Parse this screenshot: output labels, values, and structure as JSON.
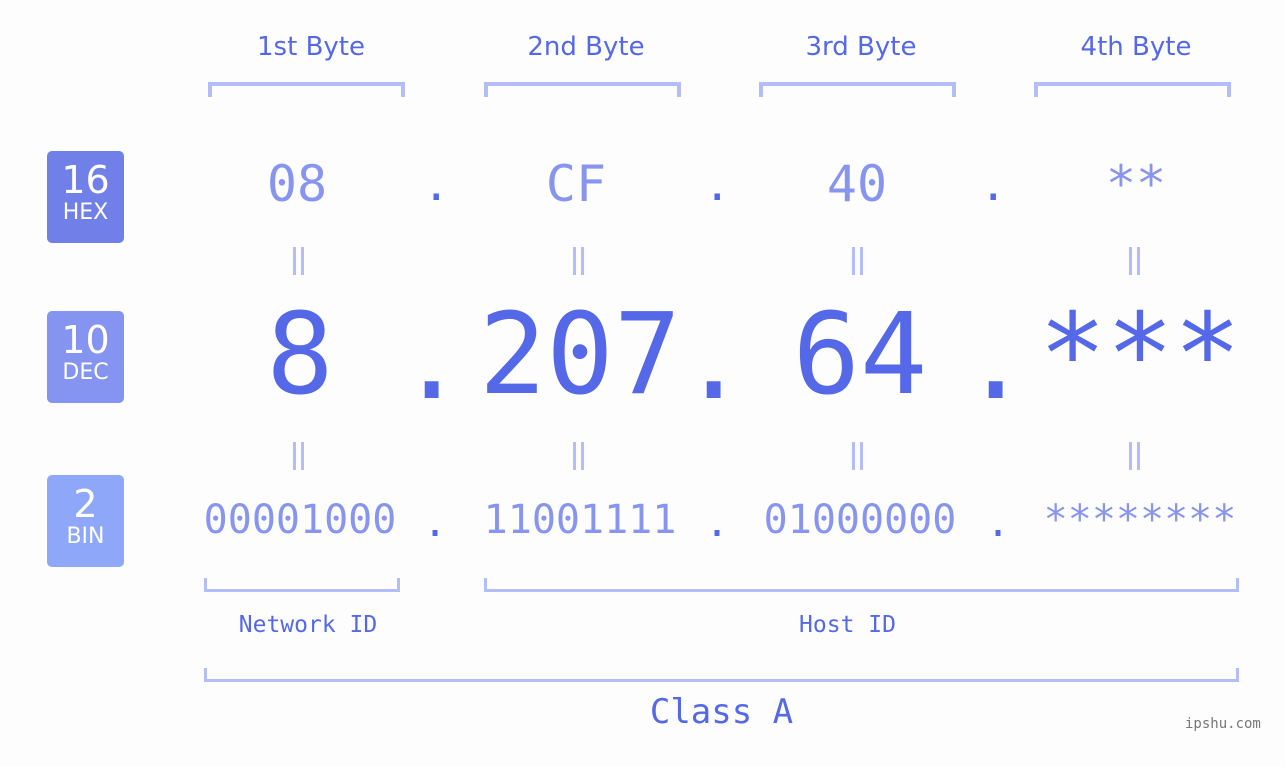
{
  "colors": {
    "accent": "#5468e8",
    "light_accent": "#8895ef",
    "bracket": "#b3bdf7",
    "hex_badge": "#717fe9",
    "dec_badge": "#8593f1",
    "bin_badge": "#8ea7f8"
  },
  "badges": [
    {
      "number": "16",
      "label": "HEX"
    },
    {
      "number": "10",
      "label": "DEC"
    },
    {
      "number": "2",
      "label": "BIN"
    }
  ],
  "byte_headers": [
    "1st Byte",
    "2nd Byte",
    "3rd Byte",
    "4th Byte"
  ],
  "hex": [
    "08",
    "CF",
    "40",
    "**"
  ],
  "dec": [
    "8",
    "207",
    "64",
    "***"
  ],
  "bin": [
    "00001000",
    "11001111",
    "01000000",
    "********"
  ],
  "separator": ".",
  "segments": {
    "network": "Network ID",
    "host": "Host ID"
  },
  "ip_class": "Class A",
  "watermark": "ipshu.com"
}
